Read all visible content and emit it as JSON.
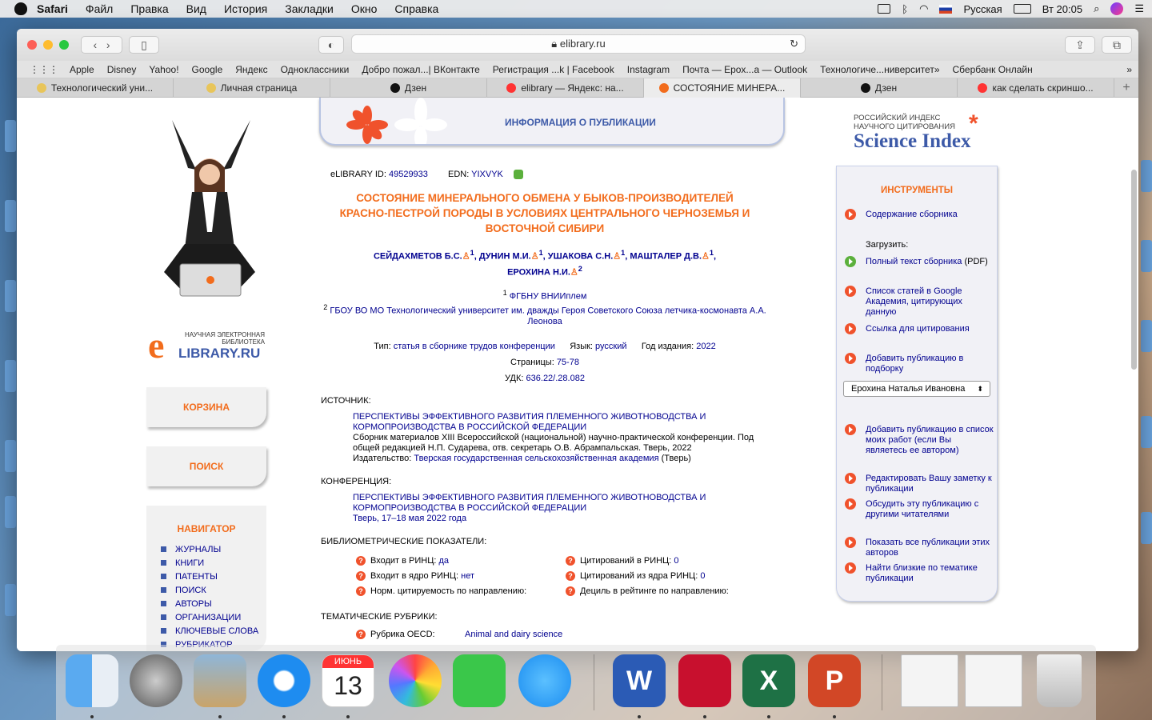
{
  "menubar": {
    "app": "Safari",
    "items": [
      "Файл",
      "Правка",
      "Вид",
      "История",
      "Закладки",
      "Окно",
      "Справка"
    ],
    "lang": "Русская",
    "clock": "Вт 20:05"
  },
  "browser": {
    "url": "elibrary.ru",
    "bookmarks": [
      "Apple",
      "Disney",
      "Yahoo!",
      "Google",
      "Яндекс",
      "Одноклассники",
      "Добро пожал...| ВКонтакте",
      "Регистрация ...k | Facebook",
      "Instagram",
      "Почта — Epox...а — Outlook",
      "Технологиче...ниверситет»",
      "Сбербанк Онлайн"
    ],
    "tabs": [
      "Технологический уни...",
      "Личная страница",
      "Дзен",
      "elibrary — Яндекс: на...",
      "СОСТОЯНИЕ МИНЕРА...",
      "Дзен",
      "как сделать скриншо..."
    ],
    "active_tab": 4
  },
  "left": {
    "logo_line1": "НАУЧНАЯ ЭЛЕКТРОННАЯ",
    "logo_line2": "БИБЛИОТЕКА",
    "logo_brand": "LIBRARY.RU",
    "cart": "КОРЗИНА",
    "search": "ПОИСК",
    "nav_title": "НАВИГАТОР",
    "nav": [
      "ЖУРНАЛЫ",
      "КНИГИ",
      "ПАТЕНТЫ",
      "ПОИСК",
      "АВТОРЫ",
      "ОРГАНИЗАЦИИ",
      "КЛЮЧЕВЫЕ СЛОВА",
      "РУБРИКАТОР"
    ]
  },
  "pub": {
    "header": "ИНФОРМАЦИЯ О ПУБЛИКАЦИИ",
    "id_label": "eLIBRARY ID:",
    "id": "49529933",
    "edn_label": "EDN:",
    "edn": "YIXVYK",
    "title": "СОСТОЯНИЕ МИНЕРАЛЬНОГО ОБМЕНА У БЫКОВ-ПРОИЗВОДИТЕЛЕЙ КРАСНО-ПЕСТРОЙ ПОРОДЫ В УСЛОВИЯХ ЦЕНТРАЛЬНОГО ЧЕРНОЗЕМЬЯ И ВОСТОЧНОЙ СИБИРИ",
    "authors_line1": "СЕЙДАХМЕТОВ Б.С.",
    "a2": "ДУНИН М.И.",
    "a3": "УШАКОВА С.Н.",
    "a4": "МАШТАЛЕР Д.В.",
    "a5": "ЕРОХИНА Н.И.",
    "sup1": "1",
    "sup2": "2",
    "aff1": "ФГБНУ ВНИИплем",
    "aff2": "ГБОУ ВО МО Технологический университет им. дважды Героя Советского Союза летчика-космонавта А.А. Леонова",
    "type_label": "Тип:",
    "type": "статья в сборнике трудов конференции",
    "lang_label": "Язык:",
    "lang": "русский",
    "year_label": "Год издания:",
    "year": "2022",
    "pages_label": "Страницы:",
    "pages": "75-78",
    "udk_label": "УДК:",
    "udk": "636.22/.28.082",
    "source_label": "ИСТОЧНИК:",
    "source_title": "ПЕРСПЕКТИВЫ ЭФФЕКТИВНОГО РАЗВИТИЯ ПЛЕМЕННОГО ЖИВОТНОВОДСТВА И КОРМОПРОИЗВОДСТВА В РОССИЙСКОЙ ФЕДЕРАЦИИ",
    "source_desc": "Сборник материалов XIII Всероссийской (национальной) научно-практической конференции. Под общей редакцией Н.П. Сударева, отв. секретарь О.В. Абрампальская. Тверь, 2022",
    "publisher_label": "Издательство:",
    "publisher": "Тверская государственная сельскохозяйственная академия",
    "publisher_city": "(Тверь)",
    "conf_label": "КОНФЕРЕНЦИЯ:",
    "conf_title": "ПЕРСПЕКТИВЫ ЭФФЕКТИВНОГО РАЗВИТИЯ ПЛЕМЕННОГО ЖИВОТНОВОДСТВА И КОРМОПРОИЗВОДСТВА В РОССИЙСКОЙ ФЕДЕРАЦИИ",
    "conf_place": "Тверь, 17–18 мая 2022 года",
    "biblio_label": "БИБЛИОМЕТРИЧЕСКИЕ ПОКАЗАТЕЛИ:",
    "m1": "Входит в РИНЦ:",
    "m1v": "да",
    "m2": "Входит в ядро РИНЦ:",
    "m2v": "нет",
    "m3": "Норм. цитируемость по направлению:",
    "m4": "Цитирований в РИНЦ:",
    "m4v": "0",
    "m5": "Цитирований из ядра РИНЦ:",
    "m5v": "0",
    "m6": "Дециль в рейтинге по направлению:",
    "rub_label": "ТЕМАТИЧЕСКИЕ РУБРИКИ:",
    "rub1": "Рубрика OECD:",
    "rub1v": "Animal and dairy science"
  },
  "right": {
    "sci_small1": "РОССИЙСКИЙ ИНДЕКС",
    "sci_small2": "НАУЧНОГО ЦИТИРОВАНИЯ",
    "sci_big": "Science Index",
    "tools_title": "ИНСТРУМЕНТЫ",
    "t1": "Содержание сборника",
    "dl_label": "Загрузить:",
    "t2": "Полный текст сборника",
    "t2_suffix": "(PDF)",
    "t3": "Список статей в Google Академия, цитирующих данную",
    "t4": "Ссылка для цитирования",
    "t5": "Добавить публикацию в подборку",
    "author_select": "Ерохина Наталья Ивановна",
    "t6": "Добавить публикацию в список моих работ (если Вы являетесь ее автором)",
    "t7": "Редактировать Вашу заметку к публикации",
    "t8": "Обсудить эту публикацию с другими читателями",
    "t9": "Показать все публикации этих авторов",
    "t10": "Найти близкие по тематике публикации"
  },
  "dock": {
    "calendar_month": "ИЮНЬ",
    "calendar_day": "13"
  }
}
